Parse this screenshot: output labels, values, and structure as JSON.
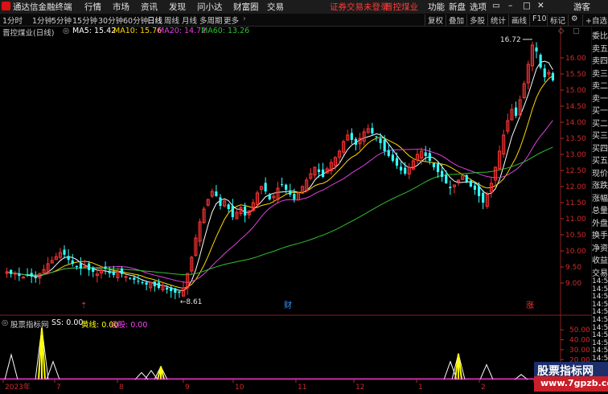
{
  "app": {
    "title": "通达信金融终端",
    "menus": [
      "行情",
      "市场",
      "资讯",
      "发现",
      "问小达",
      "财富圈",
      "交易"
    ],
    "login_notice": "证券交易未登录",
    "stock_name_top": "晋控煤业",
    "right_menus": [
      "功能",
      "新盘",
      "选项"
    ],
    "user": "游客"
  },
  "toolbar": {
    "periods": [
      "1分时",
      "1分钟",
      "5分钟",
      "15分钟",
      "30分钟",
      "60分钟",
      "日线",
      "周线",
      "月线",
      "多周期",
      "更多"
    ],
    "active_period": "日线",
    "tools": [
      "复权",
      "叠加",
      "多股",
      "统计",
      "画线",
      "F10",
      "标记"
    ],
    "add_watch": "+自选"
  },
  "main_chart": {
    "title": "晋控煤业(日线)",
    "ma": [
      {
        "label": "MA5: 15.42",
        "color": "#ffffff"
      },
      {
        "label": "MA10: 15.76",
        "color": "#ffd700"
      },
      {
        "label": "MA20: 14.72",
        "color": "#e040e0"
      },
      {
        "label": "MA60: 13.26",
        "color": "#30c030"
      }
    ],
    "high_label": "16.72",
    "low_label": "8.61",
    "event_markers": [
      {
        "text": "⇡",
        "color": "#ff3333"
      },
      {
        "text": "财",
        "color": "#3399ff"
      },
      {
        "text": "涨",
        "color": "#ff3333"
      }
    ]
  },
  "chart_data": [
    {
      "type": "candlestick",
      "title": "晋控煤业(日线)",
      "ylim": [
        8.6,
        16.7
      ],
      "y_ticks": [
        "16.00",
        "15.50",
        "15.00",
        "14.50",
        "14.00",
        "13.50",
        "13.00",
        "12.50",
        "12.00",
        "11.50",
        "11.00",
        "10.50",
        "10.00",
        "9.50",
        "9.00"
      ],
      "x_ticks": [
        "2023年",
        "7",
        "8",
        "9",
        "10",
        "11",
        "12",
        "1",
        "2",
        "3"
      ],
      "close": [
        9.35,
        9.28,
        9.3,
        9.22,
        9.18,
        9.25,
        9.2,
        9.15,
        9.3,
        9.42,
        9.6,
        9.7,
        9.82,
        9.95,
        9.88,
        9.72,
        9.6,
        9.5,
        9.45,
        9.52,
        9.4,
        9.35,
        9.28,
        9.4,
        9.45,
        9.3,
        9.25,
        9.35,
        9.28,
        9.2,
        9.15,
        9.1,
        9.05,
        9.0,
        8.95,
        9.02,
        8.9,
        8.85,
        8.92,
        8.8,
        8.75,
        8.7,
        8.7,
        8.85,
        9.3,
        9.8,
        10.4,
        10.9,
        11.3,
        11.6,
        11.85,
        11.7,
        11.4,
        11.55,
        11.3,
        11.05,
        11.2,
        11.35,
        11.1,
        11.25,
        11.5,
        11.8,
        12.0,
        11.85,
        11.6,
        11.7,
        11.95,
        12.05,
        11.9,
        11.75,
        11.6,
        11.8,
        12.0,
        12.2,
        12.4,
        12.6,
        12.45,
        12.3,
        12.55,
        12.75,
        12.9,
        13.1,
        13.4,
        13.6,
        13.45,
        13.3,
        13.5,
        13.7,
        13.8,
        13.65,
        13.55,
        13.35,
        13.1,
        12.95,
        12.8,
        12.65,
        12.5,
        12.4,
        12.6,
        12.8,
        13.0,
        13.1,
        12.95,
        12.8,
        12.6,
        12.45,
        12.3,
        12.1,
        11.95,
        12.05,
        12.2,
        12.35,
        12.15,
        12.0,
        11.9,
        11.7,
        11.5,
        11.75,
        12.1,
        12.6,
        13.1,
        13.6,
        14.05,
        14.4,
        14.2,
        14.7,
        15.2,
        15.8,
        16.4,
        16.2,
        15.7,
        15.4,
        15.55,
        15.3
      ],
      "series": [
        {
          "name": "MA5",
          "close_label": "15.42"
        },
        {
          "name": "MA10",
          "close_label": "15.76"
        },
        {
          "name": "MA20",
          "close_label": "14.72"
        },
        {
          "name": "MA60",
          "close_label": "13.26"
        }
      ]
    },
    {
      "type": "line",
      "title": "股票指标网",
      "ylim": [
        0,
        55
      ],
      "y_ticks": [
        "50.00",
        "40.00",
        "30.00",
        "20.00",
        "10.00"
      ],
      "series": [
        {
          "name": "SS",
          "label": "SS: 0.00",
          "color": "#ffffff"
        },
        {
          "name": "黄线",
          "label": "黄线: 0.00",
          "color": "#ffff00"
        },
        {
          "name": "选股",
          "label": "选股: 0.00",
          "color": "#ff40ff"
        }
      ],
      "spikes": [
        {
          "x": 14,
          "white": 25,
          "yellow": 0
        },
        {
          "x": 52,
          "white": 52,
          "yellow": 52
        },
        {
          "x": 66,
          "white": 18,
          "yellow": 0
        },
        {
          "x": 176,
          "white": 7,
          "yellow": 0
        },
        {
          "x": 188,
          "white": 9,
          "yellow": 0
        },
        {
          "x": 200,
          "white": 13,
          "yellow": 13
        },
        {
          "x": 560,
          "white": 18,
          "yellow": 0
        },
        {
          "x": 570,
          "white": 26,
          "yellow": 26
        },
        {
          "x": 605,
          "white": 15,
          "yellow": 0
        },
        {
          "x": 648,
          "white": 5,
          "yellow": 0
        }
      ]
    }
  ],
  "side_panel": {
    "labels": [
      "委比",
      "卖五",
      "卖四",
      "卖三",
      "卖二",
      "卖一",
      "买一",
      "买二",
      "买三",
      "买四",
      "买五",
      "现价",
      "涨跌",
      "涨幅",
      "总量",
      "外盘",
      "换手",
      "净资",
      "收益",
      "交易"
    ],
    "times": [
      "14:5",
      "14:5",
      "14:5",
      "14:5",
      "14:5",
      "14:5",
      "14:5",
      "14:5",
      "14:5",
      "14:5",
      "14:5",
      "14:5",
      "14:5",
      "14:5"
    ]
  },
  "watermark": {
    "name": "股票指标网",
    "url": "www.7gpzb.com"
  }
}
